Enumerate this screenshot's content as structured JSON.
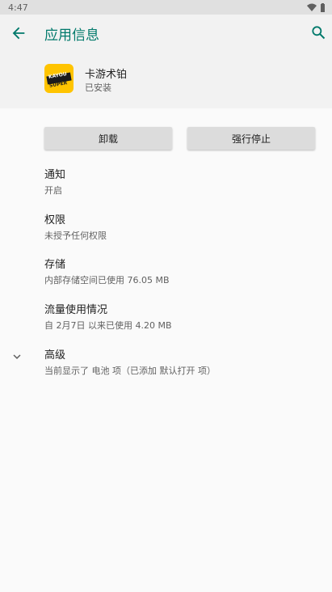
{
  "status_bar": {
    "time": "4:47"
  },
  "app_bar": {
    "title": "应用信息"
  },
  "app": {
    "name": "卡游术铂",
    "status": "已安装",
    "logo_text_1": "KAYOU",
    "logo_text_2": "SUPER"
  },
  "buttons": {
    "uninstall": "卸载",
    "force_stop": "强行停止"
  },
  "prefs": {
    "notifications": {
      "title": "通知",
      "summary": "开启"
    },
    "permissions": {
      "title": "权限",
      "summary": "未授予任何权限"
    },
    "storage": {
      "title": "存储",
      "summary": "内部存储空间已使用 76.05 MB"
    },
    "data_usage": {
      "title": "流量使用情况",
      "summary": "自 2月7日 以来已使用 4.20 MB"
    },
    "advanced": {
      "title": "高级",
      "summary": "当前显示了 电池 项（已添加 默认打开 项）"
    }
  },
  "colors": {
    "accent": "#00796b",
    "header_bg": "#f2f2f2",
    "button_bg": "#dcdcdc"
  }
}
